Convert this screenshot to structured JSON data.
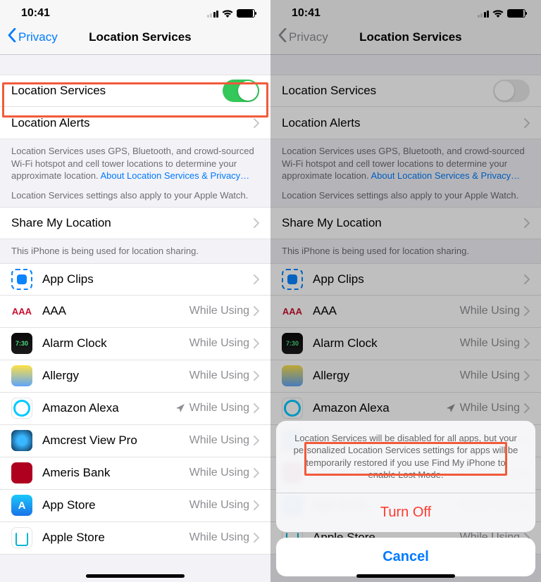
{
  "status": {
    "time": "10:41"
  },
  "nav": {
    "back": "Privacy",
    "title": "Location Services"
  },
  "rows": {
    "loc_services": "Location Services",
    "loc_alerts": "Location Alerts",
    "share": "Share My Location"
  },
  "footers": {
    "f1a": "Location Services uses GPS, Bluetooth, and crowd-sourced Wi-Fi hotspot and cell tower locations to determine your approximate location. ",
    "f1link": "About Location Services & Privacy…",
    "f1b": "Location Services settings also apply to your Apple Watch.",
    "f2": "This iPhone is being used for location sharing."
  },
  "apps": [
    {
      "name": "App Clips",
      "detail": "",
      "cls": "ac",
      "nav": false
    },
    {
      "name": "AAA",
      "detail": "While Using",
      "cls": "aaa",
      "nav": false
    },
    {
      "name": "Alarm Clock",
      "detail": "While Using",
      "cls": "alarm",
      "nav": false
    },
    {
      "name": "Allergy",
      "detail": "While Using",
      "cls": "allergy",
      "nav": false
    },
    {
      "name": "Amazon Alexa",
      "detail": "While Using",
      "cls": "alexa",
      "nav": true
    },
    {
      "name": "Amcrest View Pro",
      "detail": "While Using",
      "cls": "amcrest",
      "nav": false
    },
    {
      "name": "Ameris Bank",
      "detail": "While Using",
      "cls": "ameris",
      "nav": false
    },
    {
      "name": "App Store",
      "detail": "While Using",
      "cls": "appstore",
      "nav": false
    },
    {
      "name": "Apple Store",
      "detail": "While Using",
      "cls": "applestore",
      "nav": false
    }
  ],
  "sheet": {
    "msg": "Location Services will be disabled for all apps, but your personalized Location Services settings for apps will be temporarily restored if you use Find My iPhone to enable Lost Mode.",
    "turnoff": "Turn Off",
    "cancel": "Cancel"
  },
  "aaa_text": "AAA",
  "alarm_text": "7:30"
}
